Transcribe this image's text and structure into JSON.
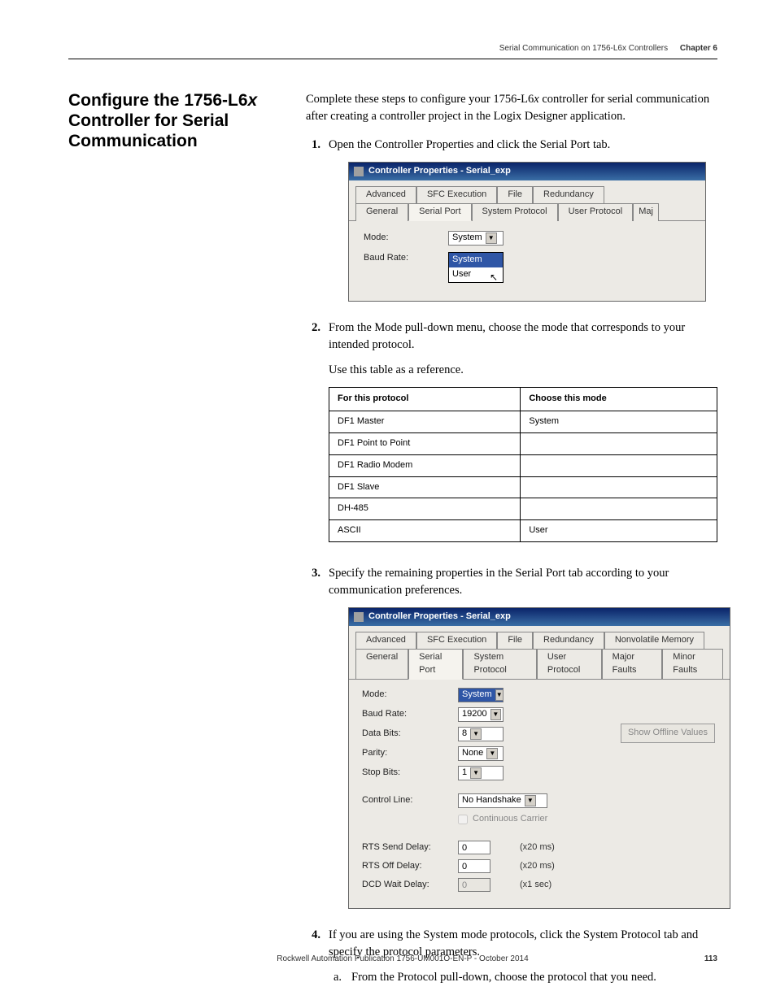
{
  "header": {
    "section_title": "Serial Communication on 1756-L6x Controllers",
    "chapter_label": "Chapter 6"
  },
  "heading": {
    "line1": "Configure the 1756-L6",
    "italic": "x",
    "line2": "Controller for Serial Communication"
  },
  "intro": {
    "pre": "Complete these steps to configure your 1756-L6",
    "italic": "x",
    "post": " controller for serial communication after creating a controller project in the Logix Designer application."
  },
  "steps": {
    "s1": {
      "num": "1.",
      "text": "Open the Controller Properties and click the Serial Port tab."
    },
    "s2": {
      "num": "2.",
      "text": "From the Mode pull-down menu, choose the mode that corresponds to your intended protocol.",
      "note": "Use this table as a reference."
    },
    "s3": {
      "num": "3.",
      "text": "Specify the remaining properties in the Serial Port tab according to your communication preferences."
    },
    "s4": {
      "num": "4.",
      "text": "If you are using the System mode protocols, click the System Protocol tab and specify the protocol parameters.",
      "sub_a": {
        "letter": "a.",
        "text": "From the Protocol pull-down, choose the protocol that you need."
      }
    }
  },
  "dlg1": {
    "title": "Controller Properties - Serial_exp",
    "tabs_row1": [
      "Advanced",
      "SFC Execution",
      "File",
      "Redundancy"
    ],
    "tabs_row2": [
      "General",
      "Serial Port",
      "System Protocol",
      "User Protocol",
      "Maj"
    ],
    "mode_label": "Mode:",
    "mode_value": "System",
    "baud_label": "Baud Rate:",
    "dd_items": [
      "System",
      "User"
    ]
  },
  "ref_table": {
    "h1": "For this protocol",
    "h2": "Choose this mode",
    "rows": [
      {
        "p": "DF1 Master",
        "m": "System"
      },
      {
        "p": "DF1 Point to Point",
        "m": ""
      },
      {
        "p": "DF1 Radio Modem",
        "m": ""
      },
      {
        "p": "DF1 Slave",
        "m": ""
      },
      {
        "p": "DH-485",
        "m": ""
      },
      {
        "p": "ASCII",
        "m": "User"
      }
    ]
  },
  "dlg2": {
    "title": "Controller Properties - Serial_exp",
    "tabs_row1": [
      "Advanced",
      "SFC Execution",
      "File",
      "Redundancy",
      "Nonvolatile Memory"
    ],
    "tabs_row2": [
      "General",
      "Serial Port",
      "System Protocol",
      "User Protocol",
      "Major Faults",
      "Minor Faults"
    ],
    "show_offline": "Show Offline Values",
    "fields": {
      "mode": {
        "label": "Mode:",
        "value": "System"
      },
      "baud": {
        "label": "Baud Rate:",
        "value": "19200"
      },
      "databits": {
        "label": "Data Bits:",
        "value": "8"
      },
      "parity": {
        "label": "Parity:",
        "value": "None"
      },
      "stopbits": {
        "label": "Stop Bits:",
        "value": "1"
      },
      "ctrlline": {
        "label": "Control Line:",
        "value": "No Handshake"
      },
      "contcarrier": {
        "label": "Continuous Carrier"
      },
      "rtssend": {
        "label": "RTS Send Delay:",
        "value": "0",
        "unit": "(x20 ms)"
      },
      "rtsoff": {
        "label": "RTS Off Delay:",
        "value": "0",
        "unit": "(x20 ms)"
      },
      "dcdwait": {
        "label": "DCD Wait Delay:",
        "value": "0",
        "unit": "(x1 sec)"
      }
    }
  },
  "footer": {
    "publication": "Rockwell Automation Publication 1756-UM001O-EN-P - October 2014",
    "page": "113"
  }
}
